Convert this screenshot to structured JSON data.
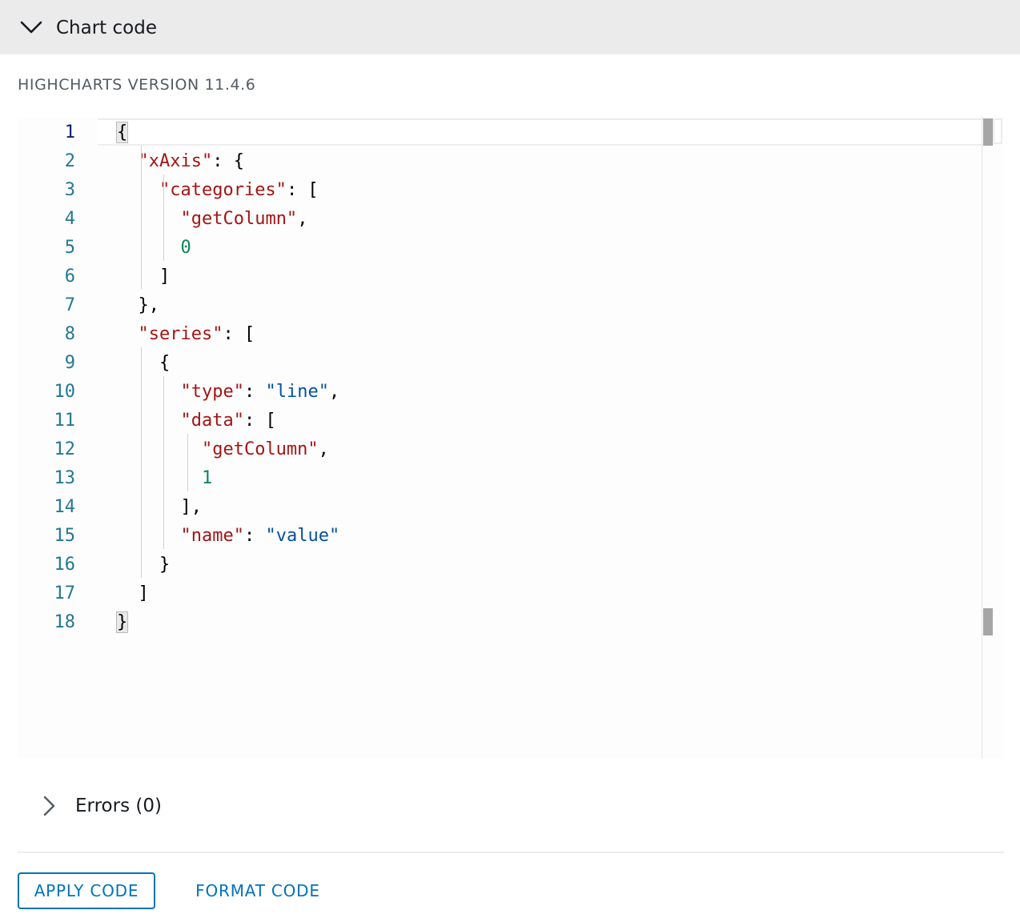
{
  "header": {
    "title": "Chart code",
    "expand_icon": "chevron-down-icon"
  },
  "version_label": "HIGHCHARTS VERSION 11.4.6",
  "editor": {
    "line_numbers": [
      "1",
      "2",
      "3",
      "4",
      "5",
      "6",
      "7",
      "8",
      "9",
      "10",
      "11",
      "12",
      "13",
      "14",
      "15",
      "16",
      "17",
      "18"
    ],
    "active_line": 1,
    "code_lines": [
      [
        {
          "t": "p",
          "v": "{"
        }
      ],
      [
        {
          "t": "p",
          "v": "  "
        },
        {
          "t": "k",
          "v": "\"xAxis\""
        },
        {
          "t": "p",
          "v": ": {"
        }
      ],
      [
        {
          "t": "p",
          "v": "    "
        },
        {
          "t": "k",
          "v": "\"categories\""
        },
        {
          "t": "p",
          "v": ": ["
        }
      ],
      [
        {
          "t": "p",
          "v": "      "
        },
        {
          "t": "k",
          "v": "\"getColumn\""
        },
        {
          "t": "p",
          "v": ","
        }
      ],
      [
        {
          "t": "p",
          "v": "      "
        },
        {
          "t": "n",
          "v": "0"
        }
      ],
      [
        {
          "t": "p",
          "v": "    ]"
        }
      ],
      [
        {
          "t": "p",
          "v": "  },"
        }
      ],
      [
        {
          "t": "p",
          "v": "  "
        },
        {
          "t": "k",
          "v": "\"series\""
        },
        {
          "t": "p",
          "v": ": ["
        }
      ],
      [
        {
          "t": "p",
          "v": "    {"
        }
      ],
      [
        {
          "t": "p",
          "v": "      "
        },
        {
          "t": "k",
          "v": "\"type\""
        },
        {
          "t": "p",
          "v": ": "
        },
        {
          "t": "s",
          "v": "\"line\""
        },
        {
          "t": "p",
          "v": ","
        }
      ],
      [
        {
          "t": "p",
          "v": "      "
        },
        {
          "t": "k",
          "v": "\"data\""
        },
        {
          "t": "p",
          "v": ": ["
        }
      ],
      [
        {
          "t": "p",
          "v": "        "
        },
        {
          "t": "k",
          "v": "\"getColumn\""
        },
        {
          "t": "p",
          "v": ","
        }
      ],
      [
        {
          "t": "p",
          "v": "        "
        },
        {
          "t": "n",
          "v": "1"
        }
      ],
      [
        {
          "t": "p",
          "v": "      ],"
        }
      ],
      [
        {
          "t": "p",
          "v": "      "
        },
        {
          "t": "k",
          "v": "\"name\""
        },
        {
          "t": "p",
          "v": ": "
        },
        {
          "t": "s",
          "v": "\"value\""
        }
      ],
      [
        {
          "t": "p",
          "v": "    }"
        }
      ],
      [
        {
          "t": "p",
          "v": "  ]"
        }
      ],
      [
        {
          "t": "p",
          "v": "}"
        }
      ]
    ],
    "colors": {
      "key": "#a31515",
      "string": "#0451a5",
      "number": "#098658",
      "line_number": "#237893",
      "active_line_number": "#0b216f"
    }
  },
  "errors": {
    "label": "Errors (0)",
    "expand_icon": "chevron-right-icon"
  },
  "buttons": {
    "apply": "APPLY CODE",
    "format": "FORMAT CODE"
  },
  "accent_color": "#0073bb"
}
